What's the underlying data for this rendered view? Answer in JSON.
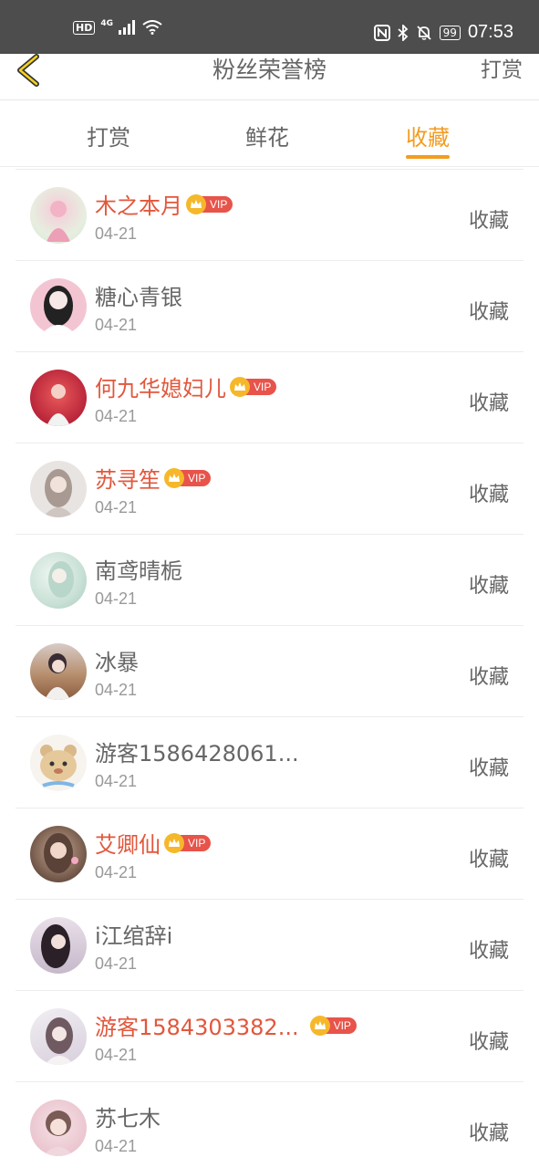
{
  "status_bar": {
    "hd": "HD",
    "network": "4G",
    "battery": "99",
    "time": "07:53",
    "icons": [
      "hd-icon",
      "signal-icon",
      "wifi-icon",
      "nfc-icon",
      "bluetooth-icon",
      "mute-bell-icon",
      "battery-icon"
    ]
  },
  "nav": {
    "back_icon": "chevron-left-icon",
    "title": "粉丝荣誉榜",
    "action": "打赏"
  },
  "tabs": [
    {
      "label": "打赏",
      "active": false
    },
    {
      "label": "鲜花",
      "active": false
    },
    {
      "label": "收藏",
      "active": true
    }
  ],
  "vip_label": "VIP",
  "accent_color": "#f29c1f",
  "vip_name_color": "#e2573c",
  "users": [
    {
      "name": "木之本月",
      "vip": true,
      "date": "04-21",
      "action": "收藏"
    },
    {
      "name": "糖心青银",
      "vip": false,
      "date": "04-21",
      "action": "收藏"
    },
    {
      "name": "何九华媳妇儿",
      "vip": true,
      "date": "04-21",
      "action": "收藏"
    },
    {
      "name": "苏寻笙",
      "vip": true,
      "date": "04-21",
      "action": "收藏"
    },
    {
      "name": "南鸢晴栀",
      "vip": false,
      "date": "04-21",
      "action": "收藏"
    },
    {
      "name": "冰暴",
      "vip": false,
      "date": "04-21",
      "action": "收藏"
    },
    {
      "name": "游客1586428061...",
      "vip": false,
      "date": "04-21",
      "action": "收藏"
    },
    {
      "name": "艾卿仙",
      "vip": true,
      "date": "04-21",
      "action": "收藏"
    },
    {
      "name": "i江绾辞i",
      "vip": false,
      "date": "04-21",
      "action": "收藏"
    },
    {
      "name": "游客1584303382...",
      "vip": true,
      "date": "04-21",
      "action": "收藏"
    },
    {
      "name": "苏七木",
      "vip": false,
      "date": "04-21",
      "action": "收藏"
    }
  ]
}
